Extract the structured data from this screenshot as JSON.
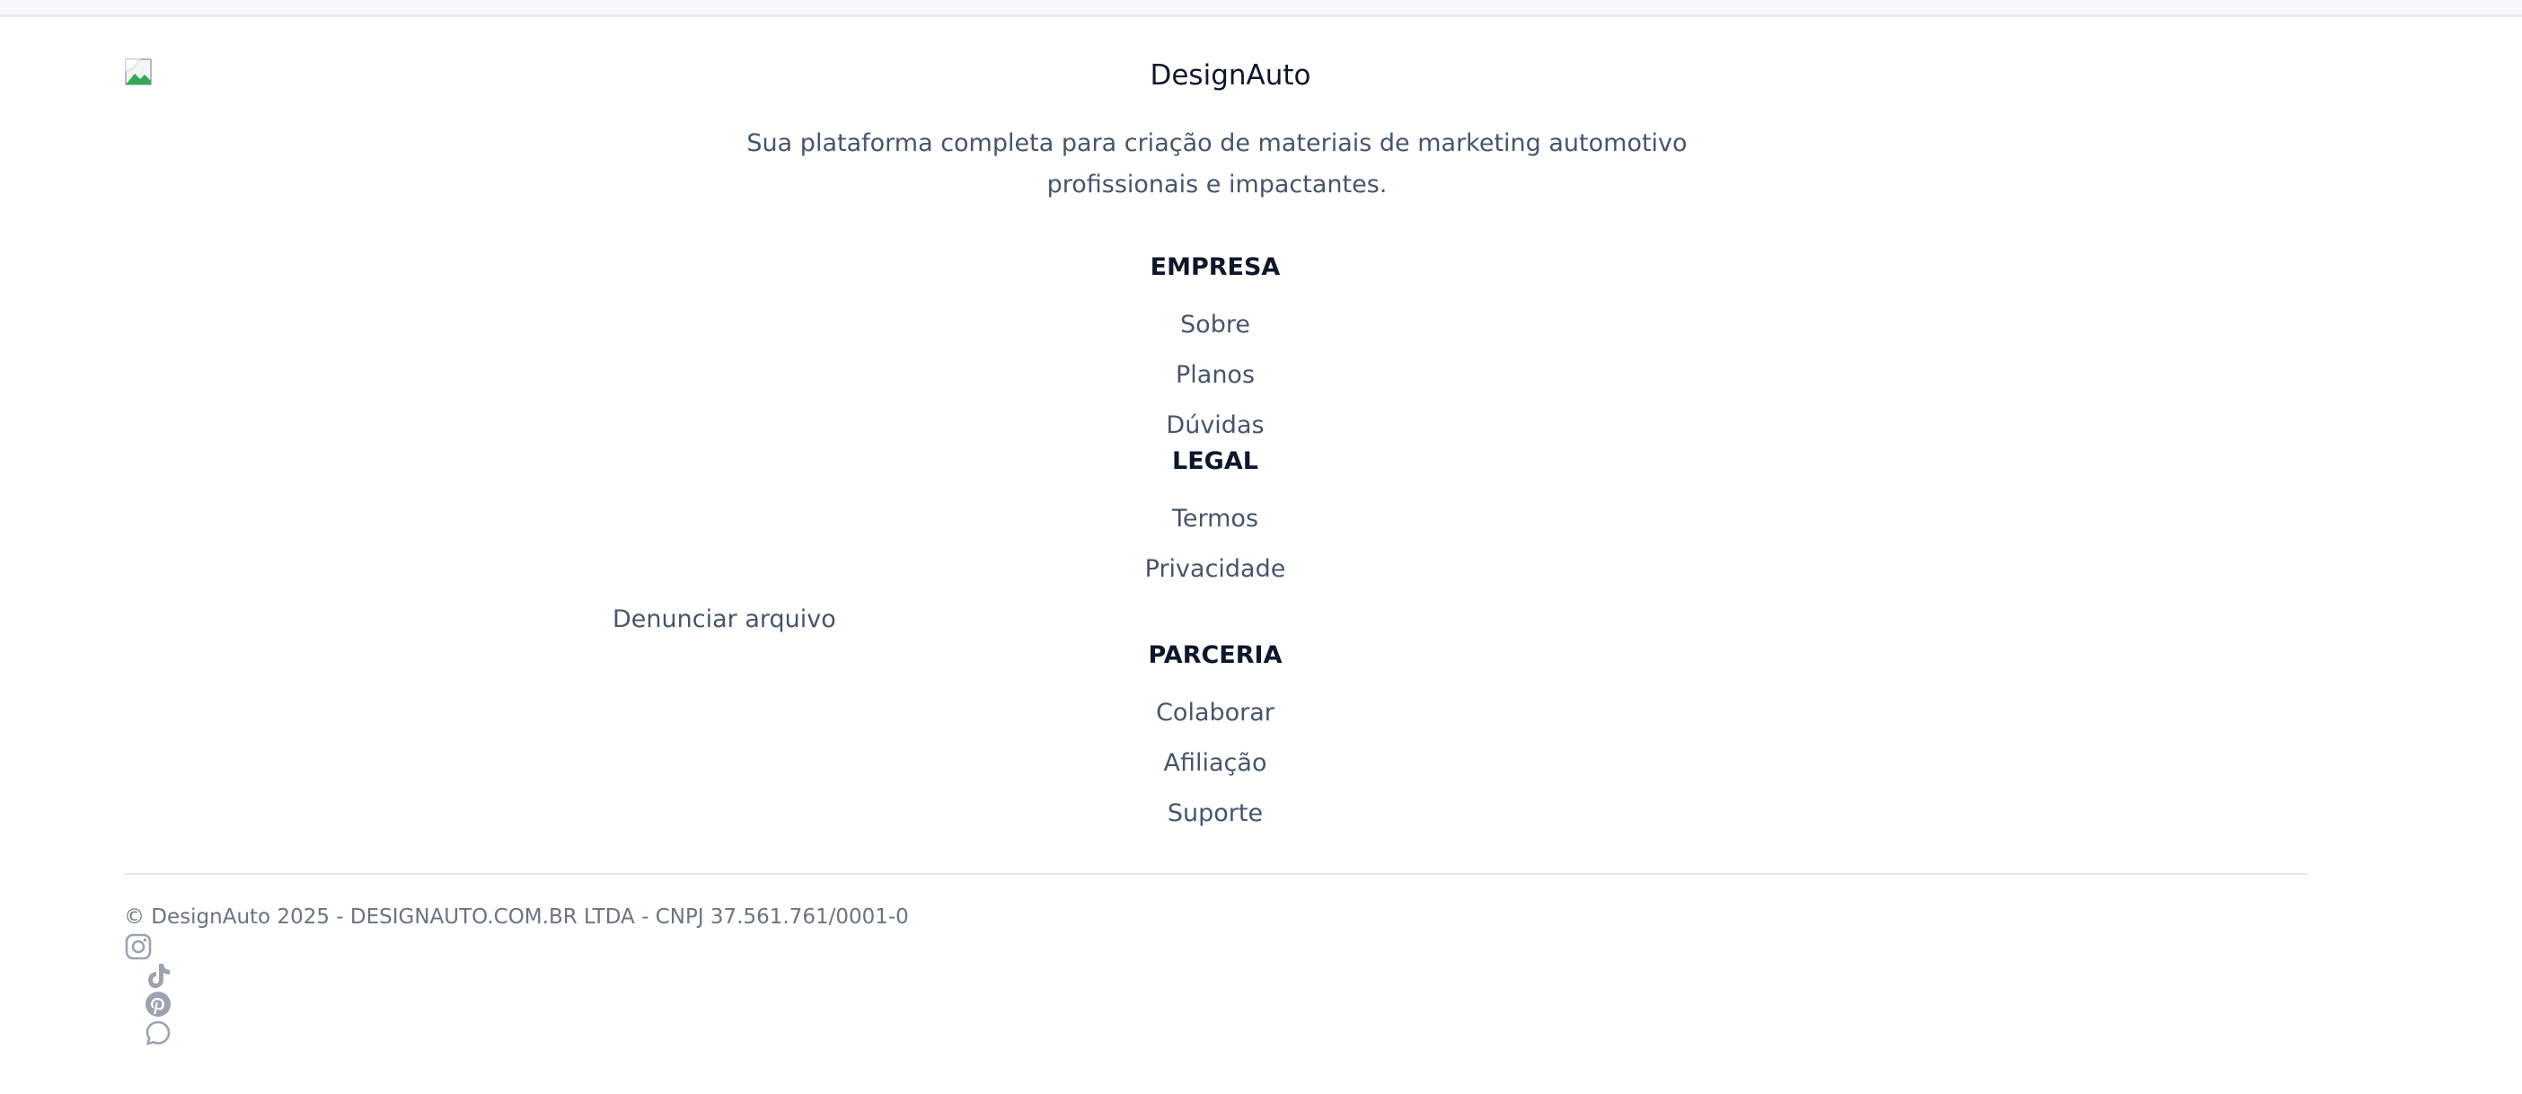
{
  "footer": {
    "brand_name": "DesignAuto",
    "tagline_line1": "Sua plataforma completa para criação de materiais de marketing automotivo",
    "tagline_line2": "profissionais e impactantes.",
    "sections": [
      {
        "title": "EMPRESA",
        "links": [
          "Sobre",
          "Planos",
          "Dúvidas"
        ]
      },
      {
        "title": "LEGAL",
        "links": [
          "Termos",
          "Privacidade",
          "Denunciar arquivo"
        ]
      },
      {
        "title": "PARCERIA",
        "links": [
          "Colaborar",
          "Afiliação",
          "Suporte"
        ]
      }
    ],
    "copyright": "© DesignAuto 2025 - DESIGNAUTO.COM.BR LTDA - CNPJ 37.561.761/0001-0",
    "social_icons": [
      "instagram-icon",
      "tiktok-icon",
      "pinterest-icon",
      "whatsapp-icon"
    ],
    "colors": {
      "heading": "#0f172a",
      "text": "#475569",
      "muted": "#6b7280",
      "icon": "#9ca3af",
      "divider": "#e5e7eb"
    }
  }
}
